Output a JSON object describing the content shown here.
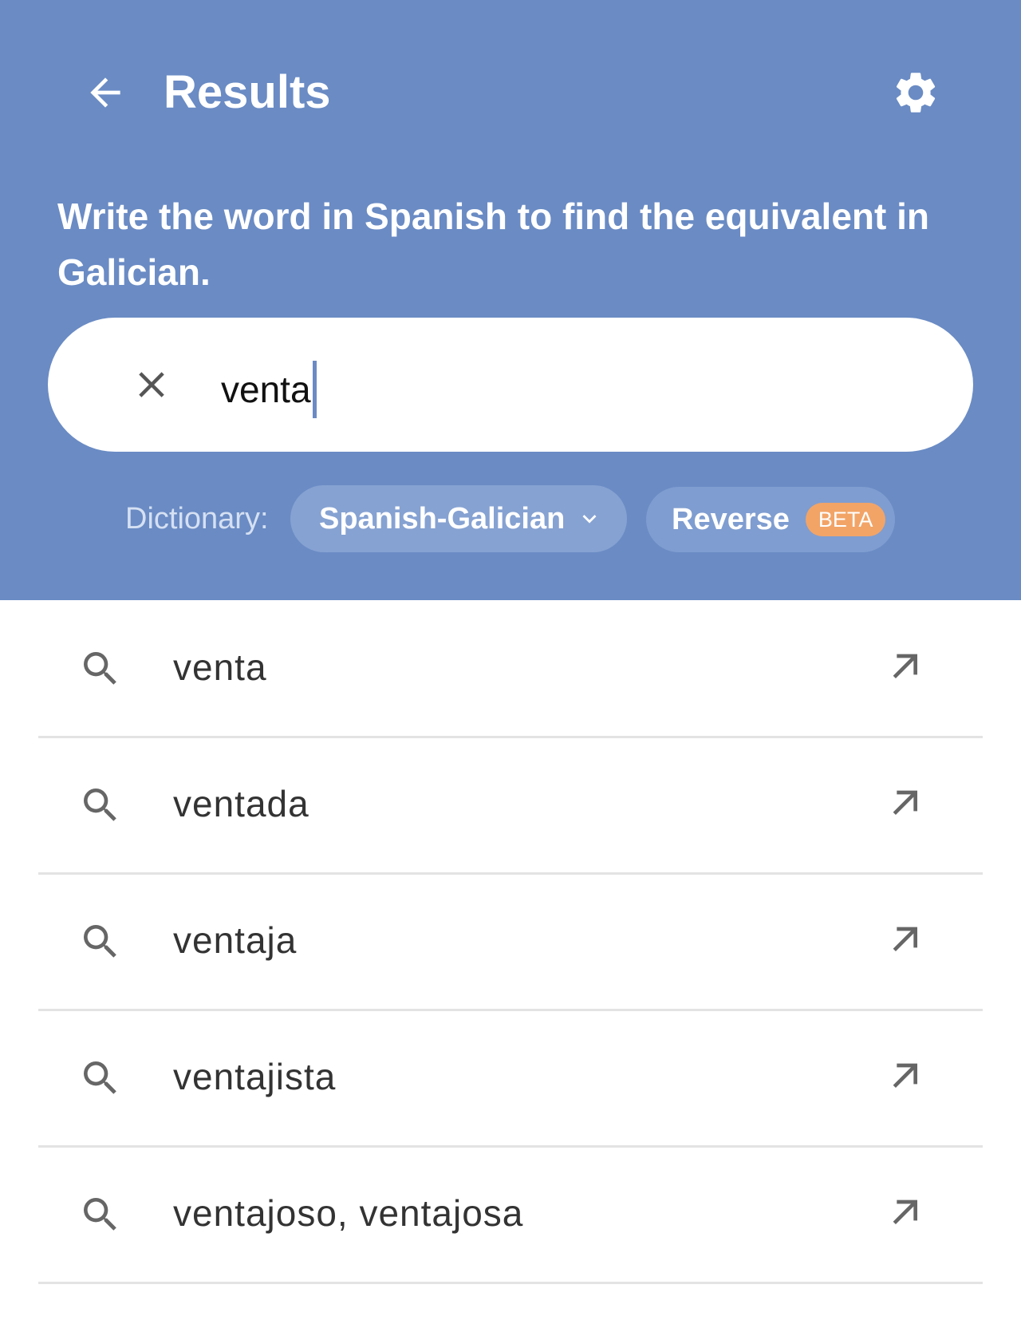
{
  "header": {
    "title": "Results",
    "instruction": "Write the word in Spanish to find the equivalent in Galician."
  },
  "search": {
    "value": "venta"
  },
  "dictionary": {
    "label": "Dictionary:",
    "selected": "Spanish-Galician",
    "reverse_label": "Reverse",
    "reverse_badge": "BETA"
  },
  "results": [
    {
      "text": "venta"
    },
    {
      "text": "ventada"
    },
    {
      "text": "ventaja"
    },
    {
      "text": "ventajista"
    },
    {
      "text": "ventajoso, ventajosa"
    }
  ],
  "colors": {
    "header_bg": "#6a8bc4",
    "chip_bg": "#86a2d2",
    "beta_badge": "#f2a467",
    "divider": "#e3e3e3"
  },
  "icons": {
    "back": "arrow-left-icon",
    "settings": "gear-icon",
    "clear": "close-icon",
    "dropdown": "chevron-down-icon",
    "result_search": "search-icon",
    "result_fill": "arrow-up-left-icon"
  }
}
